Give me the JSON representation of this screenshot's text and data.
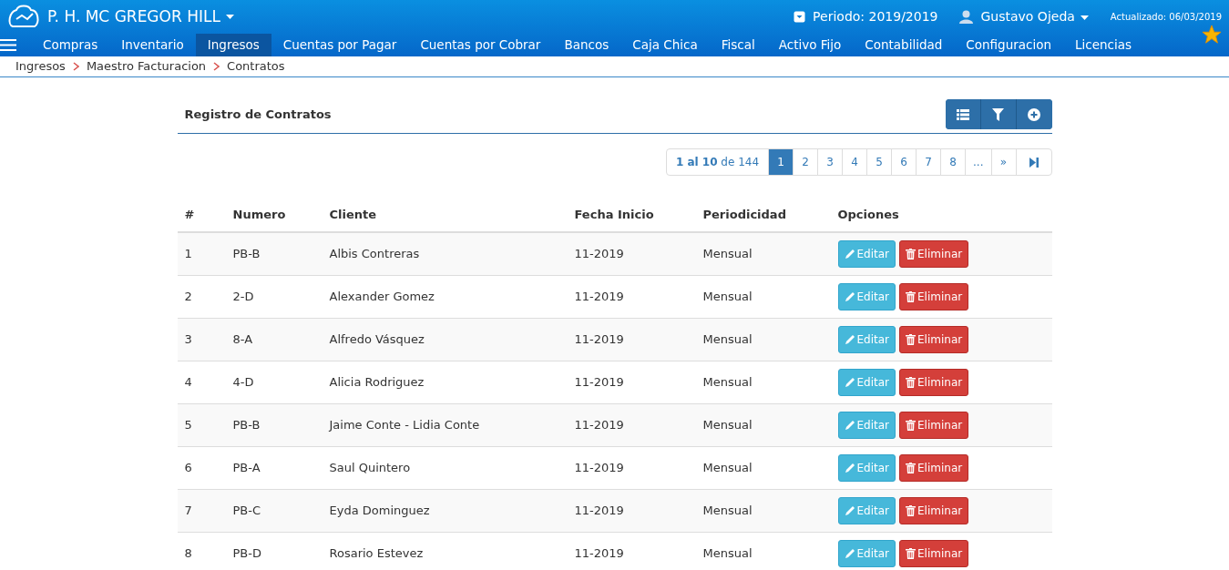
{
  "header": {
    "company": "P. H. MC GREGOR HILL",
    "period": "Periodo: 2019/2019",
    "user": "Gustavo Ojeda",
    "updated": "Actualizado: 06/03/2019"
  },
  "menu": [
    {
      "label": "Compras",
      "selected": false
    },
    {
      "label": "Inventario",
      "selected": false
    },
    {
      "label": "Ingresos",
      "selected": true
    },
    {
      "label": "Cuentas por Pagar",
      "selected": false
    },
    {
      "label": "Cuentas por Cobrar",
      "selected": false
    },
    {
      "label": "Bancos",
      "selected": false
    },
    {
      "label": "Caja Chica",
      "selected": false
    },
    {
      "label": "Fiscal",
      "selected": false
    },
    {
      "label": "Activo Fijo",
      "selected": false
    },
    {
      "label": "Contabilidad",
      "selected": false
    },
    {
      "label": "Configuracion",
      "selected": false
    },
    {
      "label": "Licencias",
      "selected": false
    }
  ],
  "breadcrumb": [
    "Ingresos",
    "Maestro Facturacion",
    "Contratos"
  ],
  "panel": {
    "title": "Registro de Contratos"
  },
  "pagination": {
    "summary": "**1 al 10** de 144",
    "pages": [
      {
        "label": "1",
        "selected": true
      },
      {
        "label": "2",
        "selected": false
      },
      {
        "label": "3",
        "selected": false
      },
      {
        "label": "4",
        "selected": false
      },
      {
        "label": "5",
        "selected": false
      },
      {
        "label": "6",
        "selected": false
      },
      {
        "label": "7",
        "selected": false
      },
      {
        "label": "8",
        "selected": false
      },
      {
        "label": "...",
        "selected": false
      },
      {
        "label": "»",
        "selected": false
      }
    ]
  },
  "table": {
    "columns": [
      "#",
      "Numero",
      "Cliente",
      "Fecha Inicio",
      "Periodicidad",
      "Opciones"
    ],
    "rows": [
      {
        "cells": [
          "1",
          "PB-B",
          "Albis Contreras",
          "11-2019",
          "Mensual"
        ],
        "actions": [
          "Editar",
          "Eliminar"
        ]
      },
      {
        "cells": [
          "2",
          "2-D",
          "Alexander Gomez",
          "11-2019",
          "Mensual"
        ],
        "actions": [
          "Editar",
          "Eliminar"
        ]
      },
      {
        "cells": [
          "3",
          "8-A",
          "Alfredo Vásquez",
          "11-2019",
          "Mensual"
        ],
        "actions": [
          "Editar",
          "Eliminar"
        ]
      },
      {
        "cells": [
          "4",
          "4-D",
          "Alicia Rodriguez",
          "11-2019",
          "Mensual"
        ],
        "actions": [
          "Editar",
          "Eliminar"
        ]
      },
      {
        "cells": [
          "5",
          "PB-B",
          "Jaime Conte - Lidia Conte",
          "11-2019",
          "Mensual"
        ],
        "actions": [
          "Editar",
          "Eliminar"
        ]
      },
      {
        "cells": [
          "6",
          "PB-A",
          "Saul Quintero",
          "11-2019",
          "Mensual"
        ],
        "actions": [
          "Editar",
          "Eliminar"
        ]
      },
      {
        "cells": [
          "7",
          "PB-C",
          "Eyda Dominguez",
          "11-2019",
          "Mensual"
        ],
        "actions": [
          "Editar",
          "Eliminar"
        ]
      },
      {
        "cells": [
          "8",
          "PB-D",
          "Rosario Estevez",
          "11-2019",
          "Mensual"
        ],
        "actions": [
          "Editar",
          "Eliminar"
        ]
      }
    ]
  }
}
